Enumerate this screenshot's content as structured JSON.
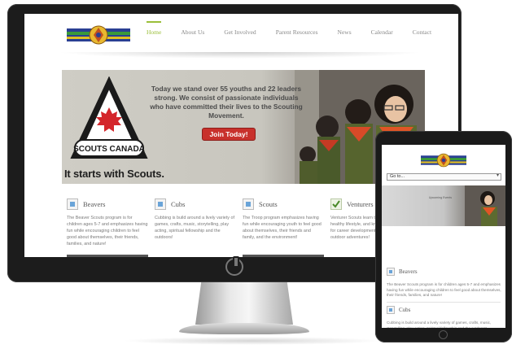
{
  "site": {
    "nav": {
      "items": [
        {
          "label": "Home",
          "active": true
        },
        {
          "label": "About Us",
          "active": false
        },
        {
          "label": "Get Involved",
          "active": false
        },
        {
          "label": "Parent Resources",
          "active": false
        },
        {
          "label": "News",
          "active": false
        },
        {
          "label": "Calendar",
          "active": false
        },
        {
          "label": "Contact",
          "active": false
        }
      ]
    },
    "hero": {
      "message": "Today we stand over 55 youths and 22 leaders strong. We consist of passionate individuals who have committed their lives to the Scouting Movement.",
      "button_label": "Join Today!",
      "tagline": "It starts with Scouts.",
      "badge_text": "SCOUTS CANADA"
    },
    "programs": [
      {
        "title": "Beavers",
        "icon": "beavers-icon",
        "body": "The Beaver Scouts program is for children ages 5-7 and emphasizes having fun while encouraging children to feel good about themselves, their friends, families, and nature!"
      },
      {
        "title": "Cubs",
        "icon": "cubs-icon",
        "body": "Cubbing is build around a lively variety of games, crafts, music, storytelling, play acting, spiritual fellowship and the outdoors!"
      },
      {
        "title": "Scouts",
        "icon": "scouts-icon",
        "body": "The Troop program emphasizes having fun while encouraging youth to feel good about themselves, their friends and family, and the environment!"
      },
      {
        "title": "Venturers",
        "icon": "check-icon",
        "body": "Venturer Scouts learn to make active, healthy lifestyle, and knowledge and skills for career development and participate outdoor adventures!"
      }
    ]
  },
  "tablet": {
    "select_label": "Go to...",
    "banner_text": "Upcoming Events",
    "programs": [
      {
        "title": "Beavers",
        "body": "The Beaver Scouts program is for children ages 5-7 and emphasizes having fun while encouraging children to feel good about themselves, their friends, families, and nature!"
      },
      {
        "title": "Cubs",
        "body": "Cubbing is build around a lively variety of games, crafts, music, storytelling, play acting, spiritual fellowship and the outdoors!"
      }
    ]
  },
  "colors": {
    "nav_active": "#9bbf3a",
    "join_button": "#c8312c",
    "badge_red": "#d4262b",
    "device_frame": "#1c1c1c"
  }
}
